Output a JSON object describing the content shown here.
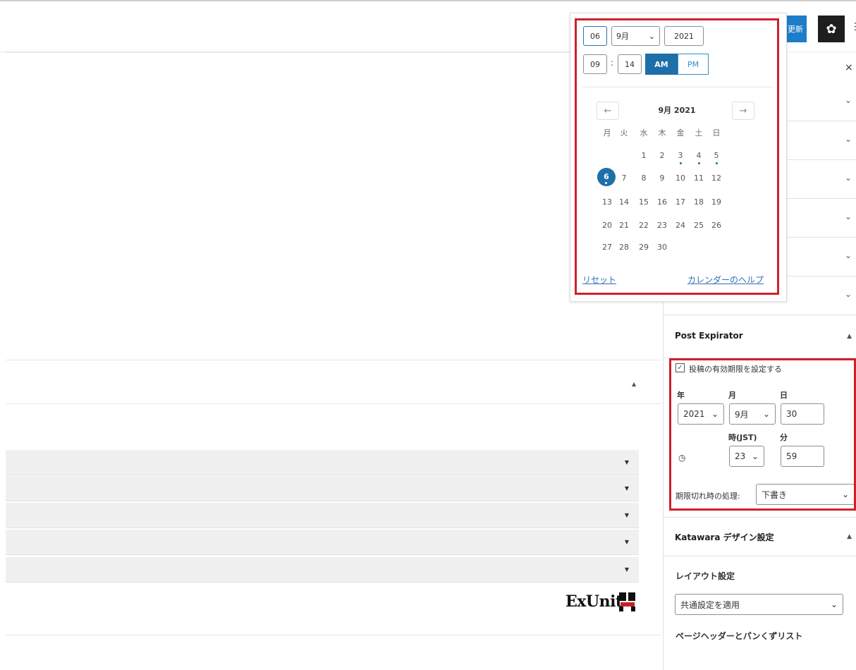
{
  "header": {
    "update_label": "更新",
    "settings_icon": "gear-icon",
    "more_icon": "vertical-ellipsis-icon"
  },
  "sidebar": {
    "close_label": "×",
    "collapsed_panels": [
      "",
      "",
      "",
      "",
      "",
      ""
    ],
    "post_expirator": {
      "title": "Post Expirator",
      "checkbox_label": "投稿の有効期限を設定する",
      "checked": true,
      "labels": {
        "year": "年",
        "month": "月",
        "day": "日",
        "hour": "時(JST)",
        "minute": "分"
      },
      "year": "2021",
      "month": "9月",
      "day": "30",
      "hour": "23",
      "minute": "59",
      "clock_icon": "clock-icon",
      "action_label": "期限切れ時の処理:",
      "action_value": "下書き"
    },
    "katawara": {
      "title": "Katawara デザイン設定",
      "layout_heading": "レイアウト設定",
      "layout_value": "共通設定を適用",
      "page_header_heading": "ページヘッダーとパンくずリスト"
    }
  },
  "datepicker": {
    "day": "06",
    "month": "9月",
    "year": "2021",
    "hour": "09",
    "minute": "14",
    "am_label": "AM",
    "pm_label": "PM",
    "prev_arrow": "←",
    "next_arrow": "→",
    "calendar_title": "9月 2021",
    "weekdays": [
      "月",
      "火",
      "水",
      "木",
      "金",
      "土",
      "日"
    ],
    "weeks": [
      [
        "",
        "",
        "1",
        "2",
        "3",
        "4",
        "5"
      ],
      [
        "6",
        "7",
        "8",
        "9",
        "10",
        "11",
        "12"
      ],
      [
        "13",
        "14",
        "15",
        "16",
        "17",
        "18",
        "19"
      ],
      [
        "20",
        "21",
        "22",
        "23",
        "24",
        "25",
        "26"
      ],
      [
        "27",
        "28",
        "29",
        "30",
        "",
        "",
        ""
      ]
    ],
    "today": "6",
    "event_days": [
      "3",
      "4",
      "5"
    ],
    "reset_label": "リセット",
    "help_label": "カレンダーのヘルプ"
  },
  "main": {
    "logo_text": "ExUnit"
  },
  "colors": {
    "accent": "#1d6fa8",
    "highlight": "#d0202a"
  }
}
